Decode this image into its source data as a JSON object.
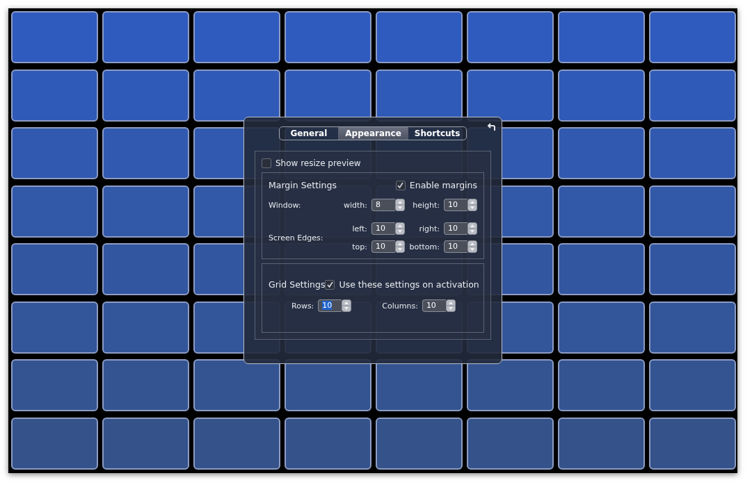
{
  "tabs": [
    {
      "label": "General",
      "selected": false
    },
    {
      "label": "Appearance",
      "selected": true
    },
    {
      "label": "Shortcuts",
      "selected": false
    }
  ],
  "show_resize_preview": {
    "label": "Show resize preview",
    "checked": false
  },
  "margin_settings": {
    "title": "Margin Settings",
    "enable": {
      "label": "Enable margins",
      "checked": true
    },
    "window_label": "Window:",
    "edges_label": "Screen Edges:",
    "window_fields": [
      {
        "label": "width:",
        "value": "8"
      },
      {
        "label": "height:",
        "value": "10"
      }
    ],
    "edge_fields": [
      {
        "label": "left:",
        "value": "10"
      },
      {
        "label": "right:",
        "value": "10"
      },
      {
        "label": "top:",
        "value": "10"
      },
      {
        "label": "bottom:",
        "value": "10"
      }
    ]
  },
  "grid_settings": {
    "title": "Grid Settings",
    "use_on_activation": {
      "label": "Use these settings on activation",
      "checked": true
    },
    "fields": [
      {
        "label": "Rows:",
        "value": "10",
        "selected": true
      },
      {
        "label": "Columns:",
        "value": "10",
        "selected": false
      }
    ]
  }
}
